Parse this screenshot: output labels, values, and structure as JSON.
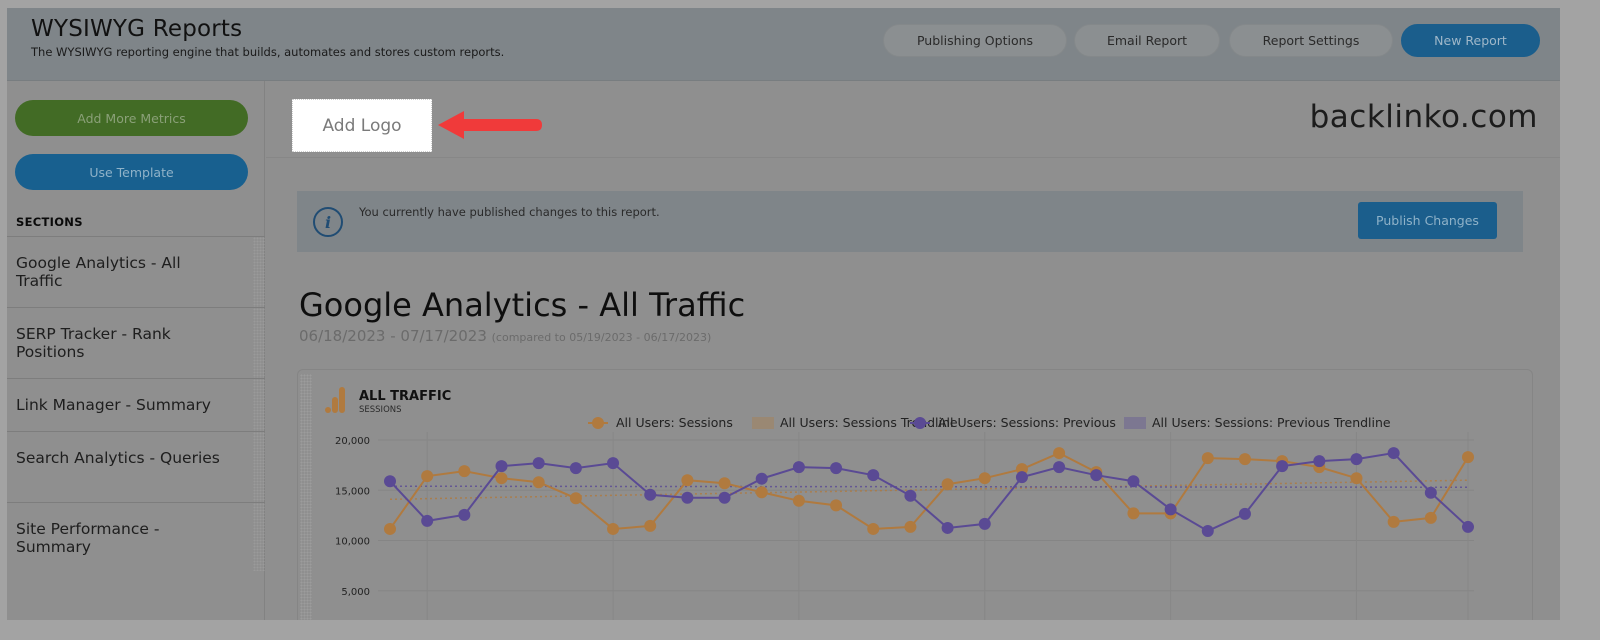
{
  "header": {
    "title": "WYSIWYG Reports",
    "subtitle": "The WYSIWYG reporting engine that builds, automates and stores custom reports.",
    "buttons": [
      {
        "label": "Publishing Options"
      },
      {
        "label": "Email Report"
      },
      {
        "label": "Report Settings"
      },
      {
        "label": "New Report"
      }
    ]
  },
  "sidebar": {
    "add_metrics_label": "Add More Metrics",
    "use_template_label": "Use Template",
    "sections_heading": "SECTIONS",
    "sections": [
      {
        "label": "Google Analytics - All Traffic"
      },
      {
        "label": "SERP Tracker - Rank Positions"
      },
      {
        "label": "Link Manager - Summary"
      },
      {
        "label": "Search Analytics - Queries"
      },
      {
        "label": "Site Performance - Summary"
      }
    ]
  },
  "main": {
    "add_logo_label": "Add Logo",
    "brand": "backlinko.com",
    "notice": {
      "icon": "info-icon",
      "text": "You currently have published changes to this report.",
      "button_label": "Publish Changes"
    },
    "report_title": "Google Analytics - All Traffic",
    "date_range": "06/18/2023 - 07/17/2023",
    "compared_range": "(compared to 05/19/2023 - 06/17/2023)",
    "card": {
      "title": "ALL TRAFFIC",
      "subtitle": "SESSIONS",
      "icon": "google-analytics-icon"
    }
  },
  "colors": {
    "sessions": "#b07a3f",
    "previous": "#5a4a94",
    "primary_button": "#1b5e8c",
    "green_button": "#426b25",
    "arrow": "#f03a3a"
  },
  "chart_data": {
    "type": "line",
    "title": "ALL TRAFFIC",
    "subtitle": "SESSIONS",
    "legend_position": "top-right",
    "ylim": [
      0,
      20000
    ],
    "yticks": [
      {
        "value": 20000,
        "label": "20,000"
      },
      {
        "value": 15000,
        "label": "15,000"
      },
      {
        "value": 10000,
        "label": "10,000"
      },
      {
        "value": 5000,
        "label": "5,000"
      }
    ],
    "grid": true,
    "series": [
      {
        "name": "All Users: Sessions",
        "kind": "line-markers",
        "color": "#b07a3f",
        "values": [
          11150,
          16400,
          16900,
          16200,
          15800,
          14200,
          11150,
          11450,
          16000,
          15700,
          14800,
          13950,
          13500,
          11150,
          11350,
          15600,
          16200,
          17100,
          18700,
          16800,
          12700,
          12700,
          18200,
          18100,
          17900,
          17300,
          16200,
          11850,
          12250,
          18300
        ]
      },
      {
        "name": "All Users: Sessions Trendline",
        "kind": "trendline",
        "color": "#b07a3f",
        "values": [
          14100,
          16000
        ]
      },
      {
        "name": "All Users: Sessions: Previous",
        "kind": "line-markers",
        "color": "#5a4a94",
        "values": [
          15900,
          11950,
          12550,
          17400,
          17700,
          17200,
          17700,
          14550,
          14250,
          14250,
          16150,
          17300,
          17200,
          16500,
          14450,
          11250,
          11650,
          16300,
          17300,
          16500,
          15900,
          13100,
          10950,
          12650,
          17400,
          17900,
          18100,
          18700,
          14750,
          11350
        ]
      },
      {
        "name": "All Users: Sessions: Previous Trendline",
        "kind": "trendline",
        "color": "#5a4a94",
        "values": [
          15400,
          15300
        ]
      }
    ]
  }
}
